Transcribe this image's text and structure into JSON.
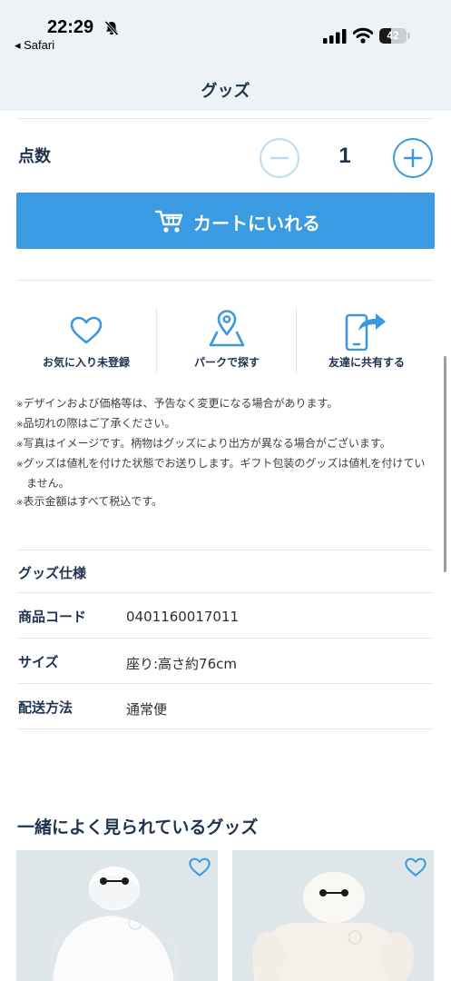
{
  "status_bar": {
    "time": "22:29",
    "back_app": "◂ Safari",
    "battery_level": "42",
    "battery_fraction": 0.42,
    "icons": [
      "bell-slash-icon",
      "signal-icon",
      "wifi-icon",
      "battery-icon"
    ]
  },
  "header": {
    "title": "グッズ"
  },
  "quantity": {
    "label": "点数",
    "value": "1"
  },
  "cart_button": {
    "label": "カートにいれる",
    "icon": "cart-icon"
  },
  "actions": [
    {
      "label": "お気に入り未登録",
      "icon": "heart-icon"
    },
    {
      "label": "パークで探す",
      "icon": "map-pin-icon"
    },
    {
      "label": "友達に共有する",
      "icon": "share-phone-icon"
    }
  ],
  "notes": [
    "デザインおよび価格等は、予告なく変更になる場合があります。",
    "品切れの際はご了承ください。",
    "写真はイメージです。柄物はグッズにより出方が異なる場合がございます。",
    "グッズは値札を付けた状態でお送りします。ギフト包装のグッズは値札を付けていません。",
    "表示金額はすべて税込です。"
  ],
  "note_mark": "※",
  "specs": {
    "heading": "グッズ仕様",
    "rows": [
      {
        "label": "商品コード",
        "value": "0401160017011"
      },
      {
        "label": "サイズ",
        "value": "座り:高さ約76cm"
      },
      {
        "label": "配送方法",
        "value": "通常便"
      }
    ]
  },
  "related": {
    "title": "一緒によく見られているグッズ",
    "cards": [
      {
        "image": "baymax-plush-standing",
        "favorite_icon": "heart-icon"
      },
      {
        "image": "baymax-plush-sitting",
        "favorite_icon": "heart-icon"
      }
    ]
  },
  "colors": {
    "accent": "#3a9be3",
    "navy_text": "#1f3350",
    "header_bg": "#ecf2f6",
    "icon_blue": "#3a98dc"
  }
}
